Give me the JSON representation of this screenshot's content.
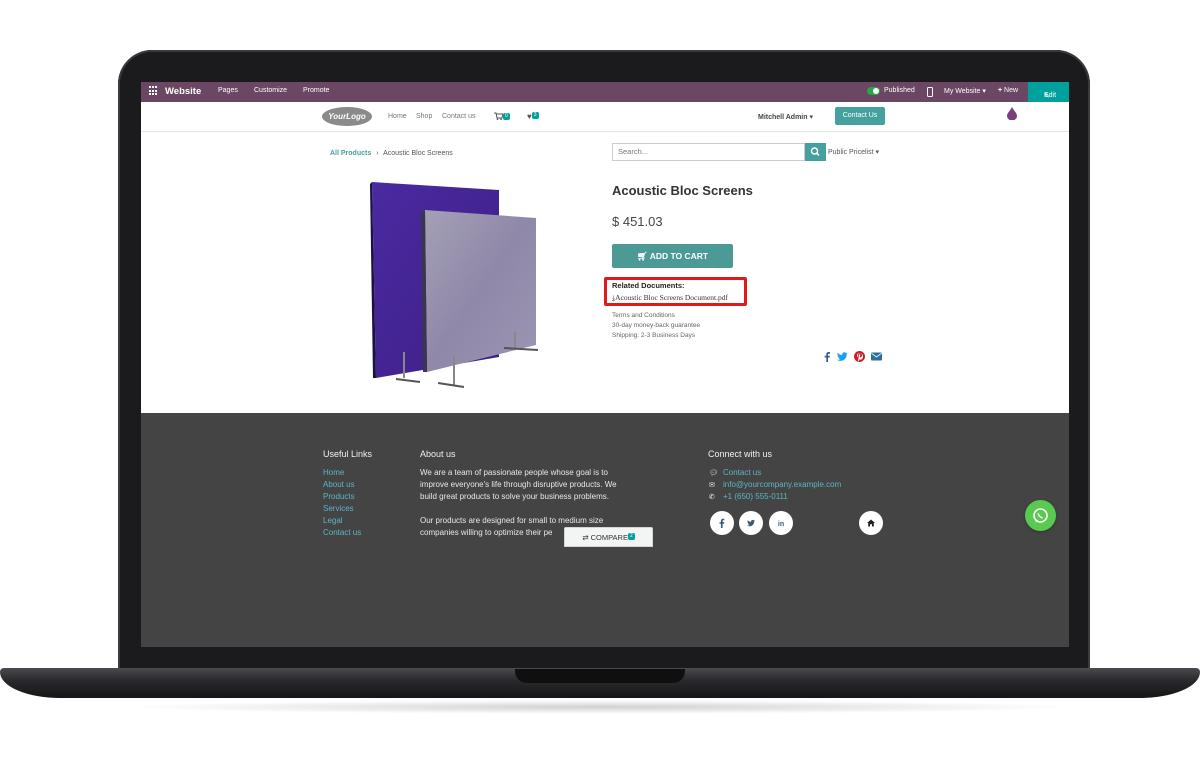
{
  "topbar": {
    "brand": "Website",
    "menu": [
      "Pages",
      "Customize",
      "Promote"
    ],
    "published": "Published",
    "my_website": "My Website",
    "new": "New",
    "edit": "Edit"
  },
  "navbar": {
    "logo": "YourLogo",
    "links": [
      "Home",
      "Shop",
      "Contact us"
    ],
    "cart_count": "0",
    "wishlist_count": "3",
    "user": "Mitchell Admin",
    "contact_button": "Contact Us"
  },
  "breadcrumb": {
    "parent": "All Products",
    "separator": "›",
    "current": "Acoustic Bloc Screens"
  },
  "search": {
    "placeholder": "Search...",
    "pricelist": "Public Pricelist"
  },
  "product": {
    "title": "Acoustic Bloc Screens",
    "price": "$ 451.03",
    "add_to_cart": "ADD TO CART",
    "docs_title": "Related Documents:",
    "docs_file": "Acoustic Bloc Screens Document.pdf",
    "info": [
      "Terms and Conditions",
      "30-day money-back guarantee",
      "Shipping: 2-3 Business Days"
    ]
  },
  "share_icons": [
    "facebook-icon",
    "twitter-icon",
    "pinterest-icon",
    "email-icon"
  ],
  "footer": {
    "useful_links_title": "Useful Links",
    "useful_links": [
      "Home",
      "About us",
      "Products",
      "Services",
      "Legal",
      "Contact us"
    ],
    "about_title": "About us",
    "about_lines": [
      "We are a team of passionate people whose goal is to",
      "improve everyone's life through disruptive products. We",
      "build great products to solve your business problems.",
      "Our products are designed for small to medium size",
      "companies willing to optimize their pe"
    ],
    "connect_title": "Connect with us",
    "contact_link": "Contact us",
    "email": "info@yourcompany.example.com",
    "phone": "+1 (650) 555-0111"
  },
  "compare": {
    "label": "COMPARE",
    "count": "2"
  },
  "colors": {
    "topbar": "#6b4763",
    "accent": "#46a09d",
    "footer": "#444444",
    "highlight": "#e01a1a"
  }
}
